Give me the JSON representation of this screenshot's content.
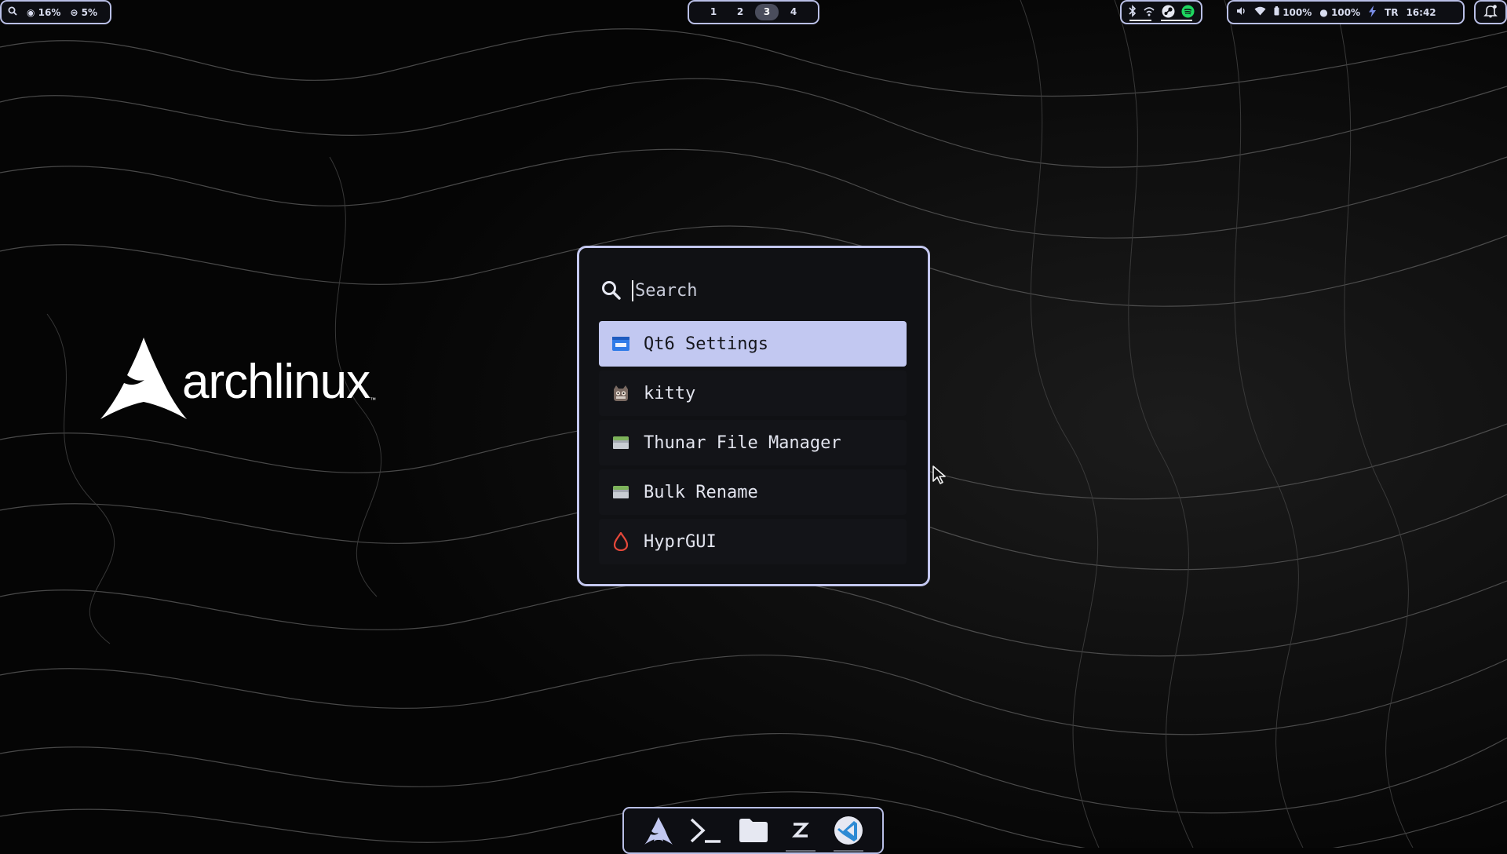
{
  "topbar": {
    "left": {
      "cpu": "16%",
      "memory": "5%"
    },
    "workspaces": [
      {
        "label": "1",
        "active": false
      },
      {
        "label": "2",
        "active": false
      },
      {
        "label": "3",
        "active": true
      },
      {
        "label": "4",
        "active": false
      }
    ],
    "tray": [
      "bluetooth-icon",
      "network-icon",
      "steam-icon",
      "spotify-icon"
    ],
    "status": {
      "volume": "100%",
      "battery": "100%",
      "keyboard_layout": "TR",
      "clock": "16:42"
    }
  },
  "launcher": {
    "search_placeholder": "Search",
    "results": [
      {
        "label": "Qt6 Settings",
        "icon": "qt6-settings-icon",
        "selected": true
      },
      {
        "label": "kitty",
        "icon": "kitty-icon",
        "selected": false
      },
      {
        "label": "Thunar File Manager",
        "icon": "thunar-icon",
        "selected": false
      },
      {
        "label": "Bulk Rename",
        "icon": "bulk-rename-icon",
        "selected": false
      },
      {
        "label": "HyprGUI",
        "icon": "hyprgui-icon",
        "selected": false
      }
    ]
  },
  "desktop": {
    "logo_text": "archlinux"
  },
  "dock": {
    "items": [
      "arch-icon",
      "terminal-icon",
      "folder-icon",
      "zed-icon",
      "vscode-icon"
    ]
  },
  "colors": {
    "accent": "#c2c8f1",
    "border": "#b9bfe6",
    "panel": "#0d0e13",
    "hyprgui_red": "#e5483a",
    "spotify_green": "#1ed760",
    "vscode_blue": "#2d8ad4"
  }
}
